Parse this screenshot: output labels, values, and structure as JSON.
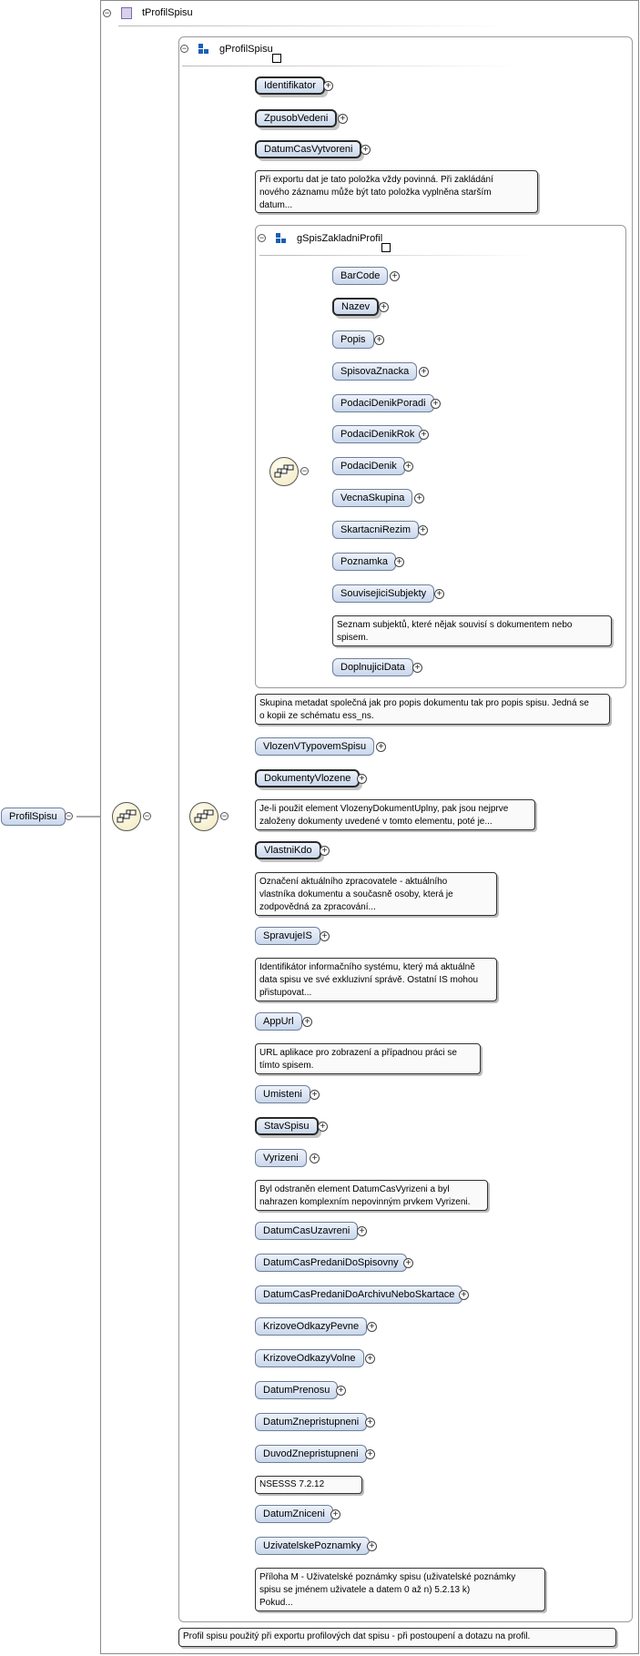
{
  "root_element": "ProfilSpisu",
  "complex_type": "tProfilSpisu",
  "group_main": "gProfilSpisu",
  "group_sub": "gSpisZakladniProfil",
  "sub_elements": [
    {
      "label": "BarCode"
    },
    {
      "label": "Nazev"
    },
    {
      "label": "Popis"
    },
    {
      "label": "SpisovaZnacka"
    },
    {
      "label": "PodaciDenikPoradi"
    },
    {
      "label": "PodaciDenikRok"
    },
    {
      "label": "PodaciDenik"
    },
    {
      "label": "VecnaSkupina"
    },
    {
      "label": "SkartacniRezim"
    },
    {
      "label": "Poznamka"
    },
    {
      "label": "SouvisejiciSubjekty"
    },
    {
      "label": "DoplnujiciData"
    }
  ],
  "main_elements": [
    {
      "label": "Identifikator"
    },
    {
      "label": "ZpusobVedeni"
    },
    {
      "label": "DatumCasVytvoreni"
    },
    {
      "label": "VlozenVTypovemSpisu"
    },
    {
      "label": "DokumentyVlozene"
    },
    {
      "label": "VlastniKdo"
    },
    {
      "label": "SpravujeIS"
    },
    {
      "label": "AppUrl"
    },
    {
      "label": "Umisteni"
    },
    {
      "label": "StavSpisu"
    },
    {
      "label": "Vyrizeni"
    },
    {
      "label": "DatumCasUzavreni"
    },
    {
      "label": "DatumCasPredaniDoSpisovny"
    },
    {
      "label": "DatumCasPredaniDoArchivuNeboSkartace"
    },
    {
      "label": "KrizoveOdkazyPevne"
    },
    {
      "label": "KrizoveOdkazyVolne"
    },
    {
      "label": "DatumPrenosu"
    },
    {
      "label": "DatumZnepristupneni"
    },
    {
      "label": "DuvodZnepristupneni"
    },
    {
      "label": "DatumZniceni"
    },
    {
      "label": "UzivatelskePoznamky"
    }
  ],
  "docs": {
    "datumCasVytvoreni": [
      "Při exportu dat je tato položka vždy povinná. Při zakládání",
      "nového záznamu může být tato položka vyplněna starším",
      "datum..."
    ],
    "souvisejiciSubjekty": [
      "Seznam subjektů, které nějak souvisí s dokumentem nebo",
      "spisem."
    ],
    "gSpisZakladniProfil": [
      "Skupina metadat společná jak pro popis dokumentu tak pro popis spisu. Jedná se",
      "o kopii ze schématu ess_ns."
    ],
    "dokumentyVlozene": [
      "Je-li použit element VlozenyDokumentUplny, pak jsou nejprve",
      "založeny dokumenty uvedené v tomto elementu, poté je..."
    ],
    "vlastniKdo": [
      "Označení aktuálního zpracovatele - aktuálního",
      "vlastníka dokumentu a současně osoby, která je",
      "zodpovědná za zpracování..."
    ],
    "spravujeIS": [
      "Identifikátor informačního systému, který má aktuálně",
      "data spisu ve své exkluzivní správě. Ostatní IS mohou",
      "přistupovat..."
    ],
    "appUrl": [
      "URL aplikace pro zobrazení a případnou práci se",
      "tímto spisem."
    ],
    "vyrizeni": [
      "Byl odstraněn element DatumCasVyrizeni a byl",
      "nahrazen komplexním nepovinným prvkem Vyrizeni."
    ],
    "duvodZnepristupneni": [
      "NSESSS 7.2.12"
    ],
    "uzivatelskePoznamky": [
      "Příloha M - Uživatelské poznámky spisu (uživatelské poznámky",
      "spisu se jménem uživatele a datem 0 až n) 5.2.13 k)",
      "Pokud..."
    ],
    "profilSpisu": [
      "Profil spisu použitý při exportu profilových dat spisu - při postoupení a dotazu na profil."
    ]
  }
}
